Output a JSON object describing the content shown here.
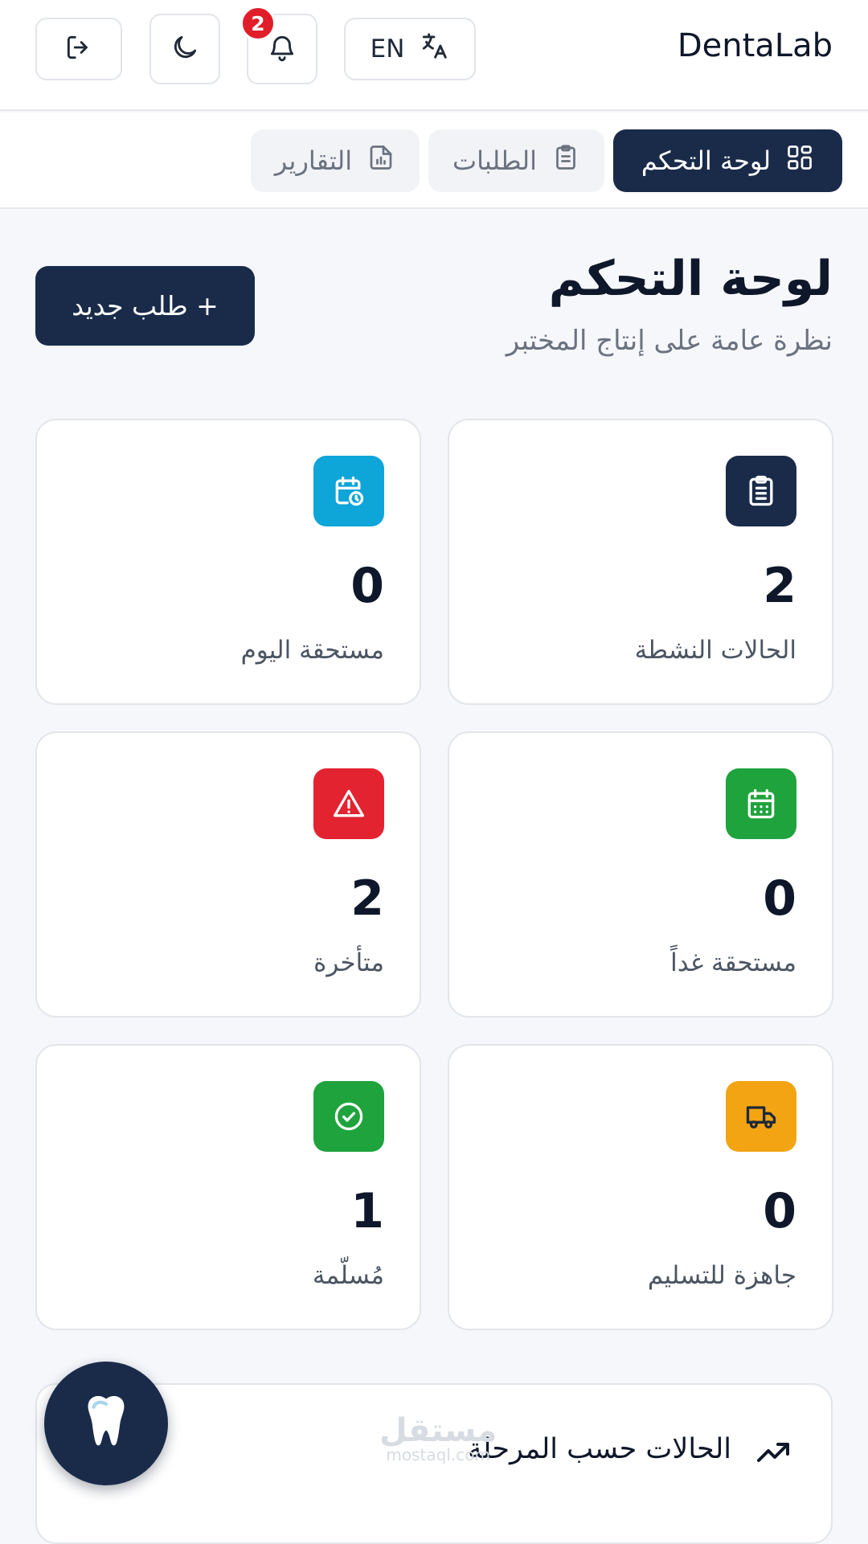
{
  "header": {
    "brand": "DentaLab",
    "lang_label": "EN",
    "notification_count": "2",
    "icons": [
      "logout-icon",
      "moon-icon",
      "bell-icon",
      "translate-icon"
    ]
  },
  "tabs": [
    {
      "label": "لوحة التحكم",
      "icon": "grid-icon",
      "active": true
    },
    {
      "label": "الطلبات",
      "icon": "clipboard-icon",
      "active": false
    },
    {
      "label": "التقارير",
      "icon": "report-icon",
      "active": false
    }
  ],
  "main": {
    "title": "لوحة التحكم",
    "subtitle": "نظرة عامة على إنتاج المختبر",
    "new_button": "+ طلب جديد"
  },
  "stats": [
    {
      "value": "2",
      "label": "الحالات النشطة",
      "icon": "clipboard-list-icon",
      "color": "#1a2b4a"
    },
    {
      "value": "0",
      "label": "مستحقة اليوم",
      "icon": "calendar-clock-icon",
      "color": "#0ea5d8"
    },
    {
      "value": "0",
      "label": "مستحقة غداً",
      "icon": "calendar-icon",
      "color": "#1fa33c"
    },
    {
      "value": "2",
      "label": "متأخرة",
      "icon": "warning-icon",
      "color": "#e32330"
    },
    {
      "value": "0",
      "label": "جاهزة للتسليم",
      "icon": "truck-icon",
      "color": "#f2a413"
    },
    {
      "value": "1",
      "label": "مُسلّمة",
      "icon": "check-circle-icon",
      "color": "#1fa33c"
    }
  ],
  "stage_section": {
    "title": "الحالات حسب المرحلة",
    "icon": "trend-up-icon"
  },
  "watermark": {
    "text": "مستقل",
    "sub": "mostaql.com"
  },
  "fab": {
    "icon": "tooth-icon"
  }
}
